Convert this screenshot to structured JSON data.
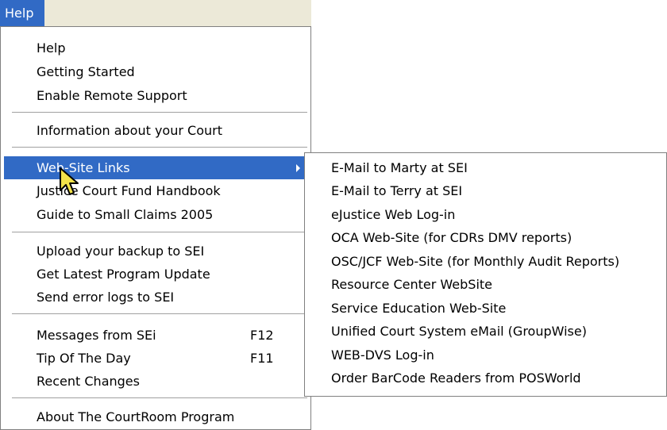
{
  "menubar": {
    "help_label": "Help"
  },
  "menu": {
    "items": [
      {
        "label": "Help"
      },
      {
        "label": "Getting Started"
      },
      {
        "label": "Enable Remote Support"
      },
      {
        "label": "Information about your Court"
      },
      {
        "label": "Web-Site Links"
      },
      {
        "label": "Justice Court Fund Handbook"
      },
      {
        "label": "Guide to Small Claims 2005"
      },
      {
        "label": "Upload your backup to SEI"
      },
      {
        "label": "Get Latest Program Update"
      },
      {
        "label": "Send error logs to SEI"
      },
      {
        "label": "Messages from SEi",
        "shortcut": "F12"
      },
      {
        "label": "Tip Of The Day",
        "shortcut": "F11"
      },
      {
        "label": "Recent Changes"
      },
      {
        "label": "About The CourtRoom Program"
      }
    ]
  },
  "submenu": {
    "items": [
      {
        "label": "E-Mail to Marty at SEI"
      },
      {
        "label": "E-Mail to Terry at SEI"
      },
      {
        "label": "eJustice Web Log-in"
      },
      {
        "label": "OCA Web-Site (for CDRs  DMV reports)"
      },
      {
        "label": "OSC/JCF Web-Site (for Monthly Audit Reports)"
      },
      {
        "label": "Resource Center WebSite"
      },
      {
        "label": "Service Education Web-Site"
      },
      {
        "label": "Unified Court System eMail (GroupWise)"
      },
      {
        "label": "WEB-DVS Log-in"
      },
      {
        "label": "Order BarCode Readers from POSWorld"
      }
    ]
  },
  "colors": {
    "highlight": "#316ac5",
    "menubar": "#ece9d8"
  }
}
